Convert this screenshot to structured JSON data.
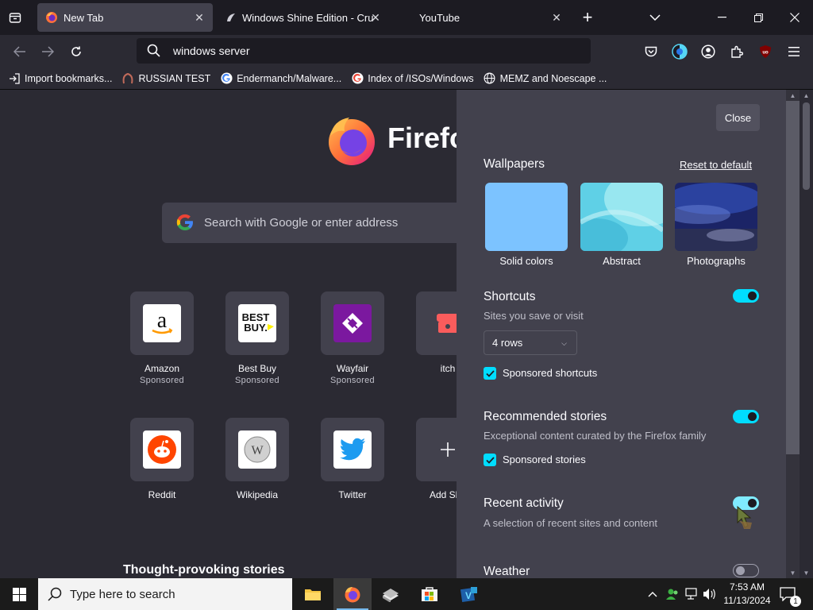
{
  "tabs": [
    {
      "title": "New Tab",
      "active": true
    },
    {
      "title": "Windows Shine Edition - Crusty",
      "active": false
    },
    {
      "title": "YouTube",
      "active": false
    }
  ],
  "urlbar": {
    "value": "windows server"
  },
  "bookmarks": [
    {
      "label": "Import bookmarks...",
      "icon": "import-icon"
    },
    {
      "label": "RUSSIAN TEST",
      "icon": "site-icon"
    },
    {
      "label": "Endermanch/Malware...",
      "icon": "google-icon"
    },
    {
      "label": "Index of /ISOs/Windows",
      "icon": "google-icon"
    },
    {
      "label": "MEMZ and Noescape ...",
      "icon": "globe-icon"
    }
  ],
  "newtab": {
    "brand": "Firefox",
    "search_placeholder": "Search with Google or enter address",
    "shortcuts_row1": [
      {
        "label": "Amazon",
        "sub": "Sponsored"
      },
      {
        "label": "Best Buy",
        "sub": "Sponsored"
      },
      {
        "label": "Wayfair",
        "sub": "Sponsored"
      },
      {
        "label": "itch",
        "sub": ""
      }
    ],
    "shortcuts_row2": [
      {
        "label": "Reddit"
      },
      {
        "label": "Wikipedia"
      },
      {
        "label": "Twitter"
      },
      {
        "label": "Add Sho"
      }
    ],
    "stories_heading": "Thought-provoking stories"
  },
  "panel": {
    "close_label": "Close",
    "wallpapers_heading": "Wallpapers",
    "reset_label": "Reset to default",
    "wallpapers": [
      {
        "label": "Solid colors"
      },
      {
        "label": "Abstract"
      },
      {
        "label": "Photographs"
      }
    ],
    "shortcuts": {
      "heading": "Shortcuts",
      "sub": "Sites you save or visit",
      "rows": "4 rows",
      "sponsored": "Sponsored shortcuts",
      "enabled": true
    },
    "recommended": {
      "heading": "Recommended stories",
      "sub": "Exceptional content curated by the Firefox family",
      "sponsored": "Sponsored stories",
      "enabled": true
    },
    "recent": {
      "heading": "Recent activity",
      "sub": "A selection of recent sites and content",
      "enabled": true
    },
    "weather": {
      "heading": "Weather",
      "enabled": false
    }
  },
  "taskbar": {
    "search_placeholder": "Type here to search",
    "time": "7:53 AM",
    "date": "11/13/2024",
    "notification_count": "1"
  },
  "colors": {
    "accent": "#00ddff",
    "panel_bg": "#42414d",
    "page_bg": "#2b2a33"
  }
}
